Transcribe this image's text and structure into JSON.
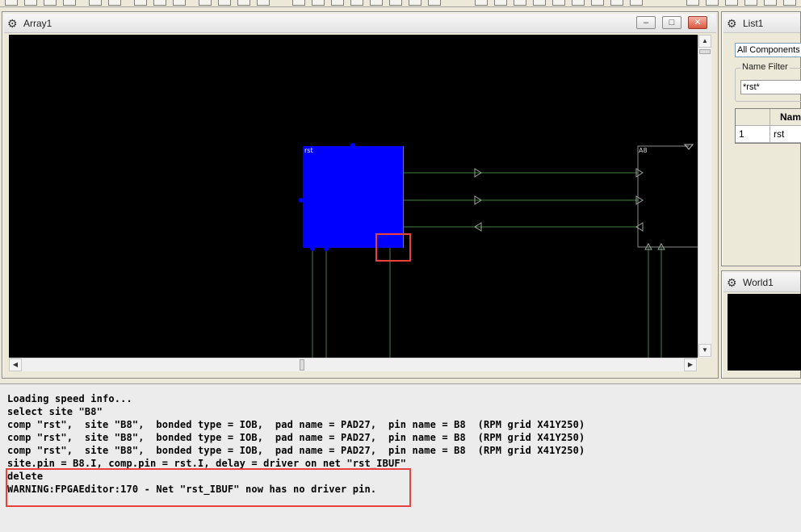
{
  "colors": {
    "canvas_bg": "#000000",
    "component_fill": "#0000ff",
    "net_line": "#3f7f3f",
    "site_outline": "#8c8c8c",
    "highlight_box": "#e8423c"
  },
  "array_window": {
    "title": "Array1",
    "icon": "gear-icon",
    "component_label": "rst",
    "site_label": "A8",
    "controls": {
      "minimize": "–",
      "restore": "□",
      "close": "✕"
    }
  },
  "list_window": {
    "title": "List1",
    "icon": "gear-icon",
    "filter_combo_value": "All Components",
    "name_filter_label": "Name Filter",
    "name_filter_value": "*rst*",
    "table": {
      "columns": [
        "",
        "Nam"
      ],
      "rows": [
        {
          "index": "1",
          "name": "rst"
        }
      ]
    }
  },
  "world_window": {
    "title": "World1",
    "icon": "gear-icon"
  },
  "console": {
    "lines": [
      "Loading speed info...",
      "select site \"B8\"",
      "comp \"rst\",  site \"B8\",  bonded type = IOB,  pad name = PAD27,  pin name = B8  (RPM grid X41Y250)",
      "comp \"rst\",  site \"B8\",  bonded type = IOB,  pad name = PAD27,  pin name = B8  (RPM grid X41Y250)",
      "comp \"rst\",  site \"B8\",  bonded type = IOB,  pad name = PAD27,  pin name = B8  (RPM grid X41Y250)",
      "site.pin = B8.I, comp.pin = rst.I, delay = driver on net \"rst_IBUF\"",
      "delete",
      "WARNING:FPGAEditor:170 - Net \"rst_IBUF\" now has no driver pin."
    ]
  }
}
